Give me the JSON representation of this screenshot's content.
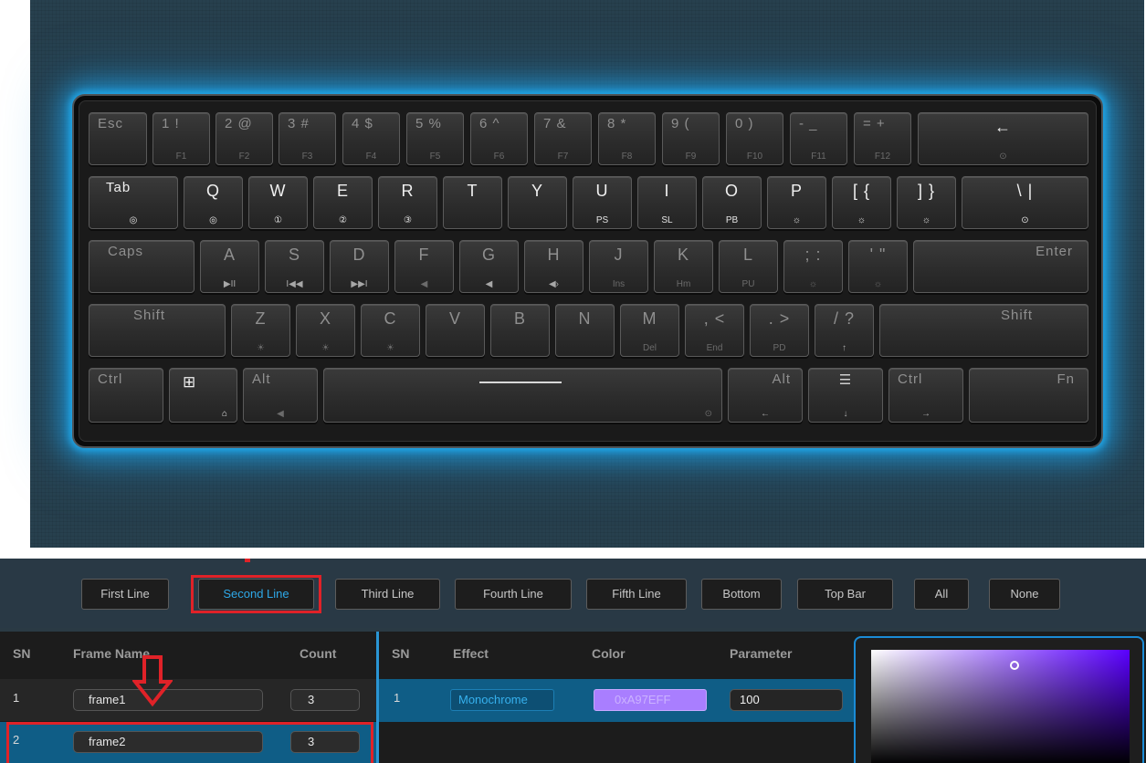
{
  "keyboard": {
    "row1": [
      {
        "label": "Esc",
        "sub": ""
      },
      {
        "label": "1 !",
        "sub": "F1"
      },
      {
        "label": "2 @",
        "sub": "F2"
      },
      {
        "label": "3 #",
        "sub": "F3"
      },
      {
        "label": "4 $",
        "sub": "F4"
      },
      {
        "label": "5 %",
        "sub": "F5"
      },
      {
        "label": "6 ^",
        "sub": "F6"
      },
      {
        "label": "7 &",
        "sub": "F7"
      },
      {
        "label": "8 *",
        "sub": "F8"
      },
      {
        "label": "9 (",
        "sub": "F9"
      },
      {
        "label": "0 )",
        "sub": "F10"
      },
      {
        "label": "- _",
        "sub": "F11"
      },
      {
        "label": "= +",
        "sub": "F12"
      },
      {
        "label": "←",
        "sub": "⊙"
      }
    ],
    "row2": [
      {
        "label": "Tab",
        "sub": "◎"
      },
      {
        "label": "Q",
        "sub": "◎"
      },
      {
        "label": "W",
        "sub": "①"
      },
      {
        "label": "E",
        "sub": "②"
      },
      {
        "label": "R",
        "sub": "③"
      },
      {
        "label": "T",
        "sub": ""
      },
      {
        "label": "Y",
        "sub": ""
      },
      {
        "label": "U",
        "sub": "PS"
      },
      {
        "label": "I",
        "sub": "SL"
      },
      {
        "label": "O",
        "sub": "PB"
      },
      {
        "label": "P",
        "sub": "☼"
      },
      {
        "label": "[ {",
        "sub": "☼"
      },
      {
        "label": "] }",
        "sub": "☼"
      },
      {
        "label": "\\ |",
        "sub": "⊙"
      }
    ],
    "row3": [
      {
        "label": "Caps",
        "sub": ""
      },
      {
        "label": "A",
        "sub": "▶II"
      },
      {
        "label": "S",
        "sub": "I◀◀"
      },
      {
        "label": "D",
        "sub": "▶▶I"
      },
      {
        "label": "F",
        "sub": "◀"
      },
      {
        "label": "G",
        "sub": "◀"
      },
      {
        "label": "H",
        "sub": "◀›"
      },
      {
        "label": "J",
        "sub": "Ins"
      },
      {
        "label": "K",
        "sub": "Hm"
      },
      {
        "label": "L",
        "sub": "PU"
      },
      {
        "label": "; :",
        "sub": "☼"
      },
      {
        "label": "' \"",
        "sub": "☼"
      },
      {
        "label": "Enter",
        "sub": ""
      }
    ],
    "row4": [
      {
        "label": "Shift",
        "sub": ""
      },
      {
        "label": "Z",
        "sub": "☀"
      },
      {
        "label": "X",
        "sub": "☀"
      },
      {
        "label": "C",
        "sub": "☀"
      },
      {
        "label": "V",
        "sub": ""
      },
      {
        "label": "B",
        "sub": ""
      },
      {
        "label": "N",
        "sub": ""
      },
      {
        "label": "M",
        "sub": "Del"
      },
      {
        "label": ", <",
        "sub": "End"
      },
      {
        "label": ". >",
        "sub": "PD"
      },
      {
        "label": "/ ?",
        "sub": "↑"
      },
      {
        "label": "Shift",
        "sub": ""
      }
    ],
    "row5": [
      {
        "label": "Ctrl",
        "sub": ""
      },
      {
        "label": "⊞",
        "sub": "⌂"
      },
      {
        "label": "Alt",
        "sub": "◀"
      },
      {
        "label": "",
        "sub": "⊙"
      },
      {
        "label": "Alt",
        "sub": "←"
      },
      {
        "label": "☰",
        "sub": "↓"
      },
      {
        "label": "Ctrl",
        "sub": "→"
      },
      {
        "label": "Fn",
        "sub": ""
      }
    ]
  },
  "tabs": [
    {
      "label": "First Line"
    },
    {
      "label": "Second Line"
    },
    {
      "label": "Third Line"
    },
    {
      "label": "Fourth Line"
    },
    {
      "label": "Fifth Line"
    },
    {
      "label": "Bottom"
    },
    {
      "label": "Top Bar"
    },
    {
      "label": "All"
    },
    {
      "label": "None"
    }
  ],
  "active_tab": "Second Line",
  "frame_table": {
    "headers": {
      "sn": "SN",
      "name": "Frame Name",
      "count": "Count"
    },
    "rows": [
      {
        "sn": "1",
        "name": "frame1",
        "count": "3"
      },
      {
        "sn": "2",
        "name": "frame2",
        "count": "3"
      }
    ]
  },
  "effect_table": {
    "headers": {
      "sn": "SN",
      "effect": "Effect",
      "color": "Color",
      "parameter": "Parameter"
    },
    "rows": [
      {
        "sn": "1",
        "effect": "Monochrome",
        "color": "0xA97EFF",
        "parameter": "100"
      }
    ]
  },
  "colors": {
    "accent": "#2ea8e8",
    "selected_row": "#0f5d86",
    "highlight_red": "#e02228",
    "swatch": "#A97EFF",
    "glow": "#1fa8ea"
  },
  "annotations": {
    "arrow": "down-arrow-icon"
  }
}
